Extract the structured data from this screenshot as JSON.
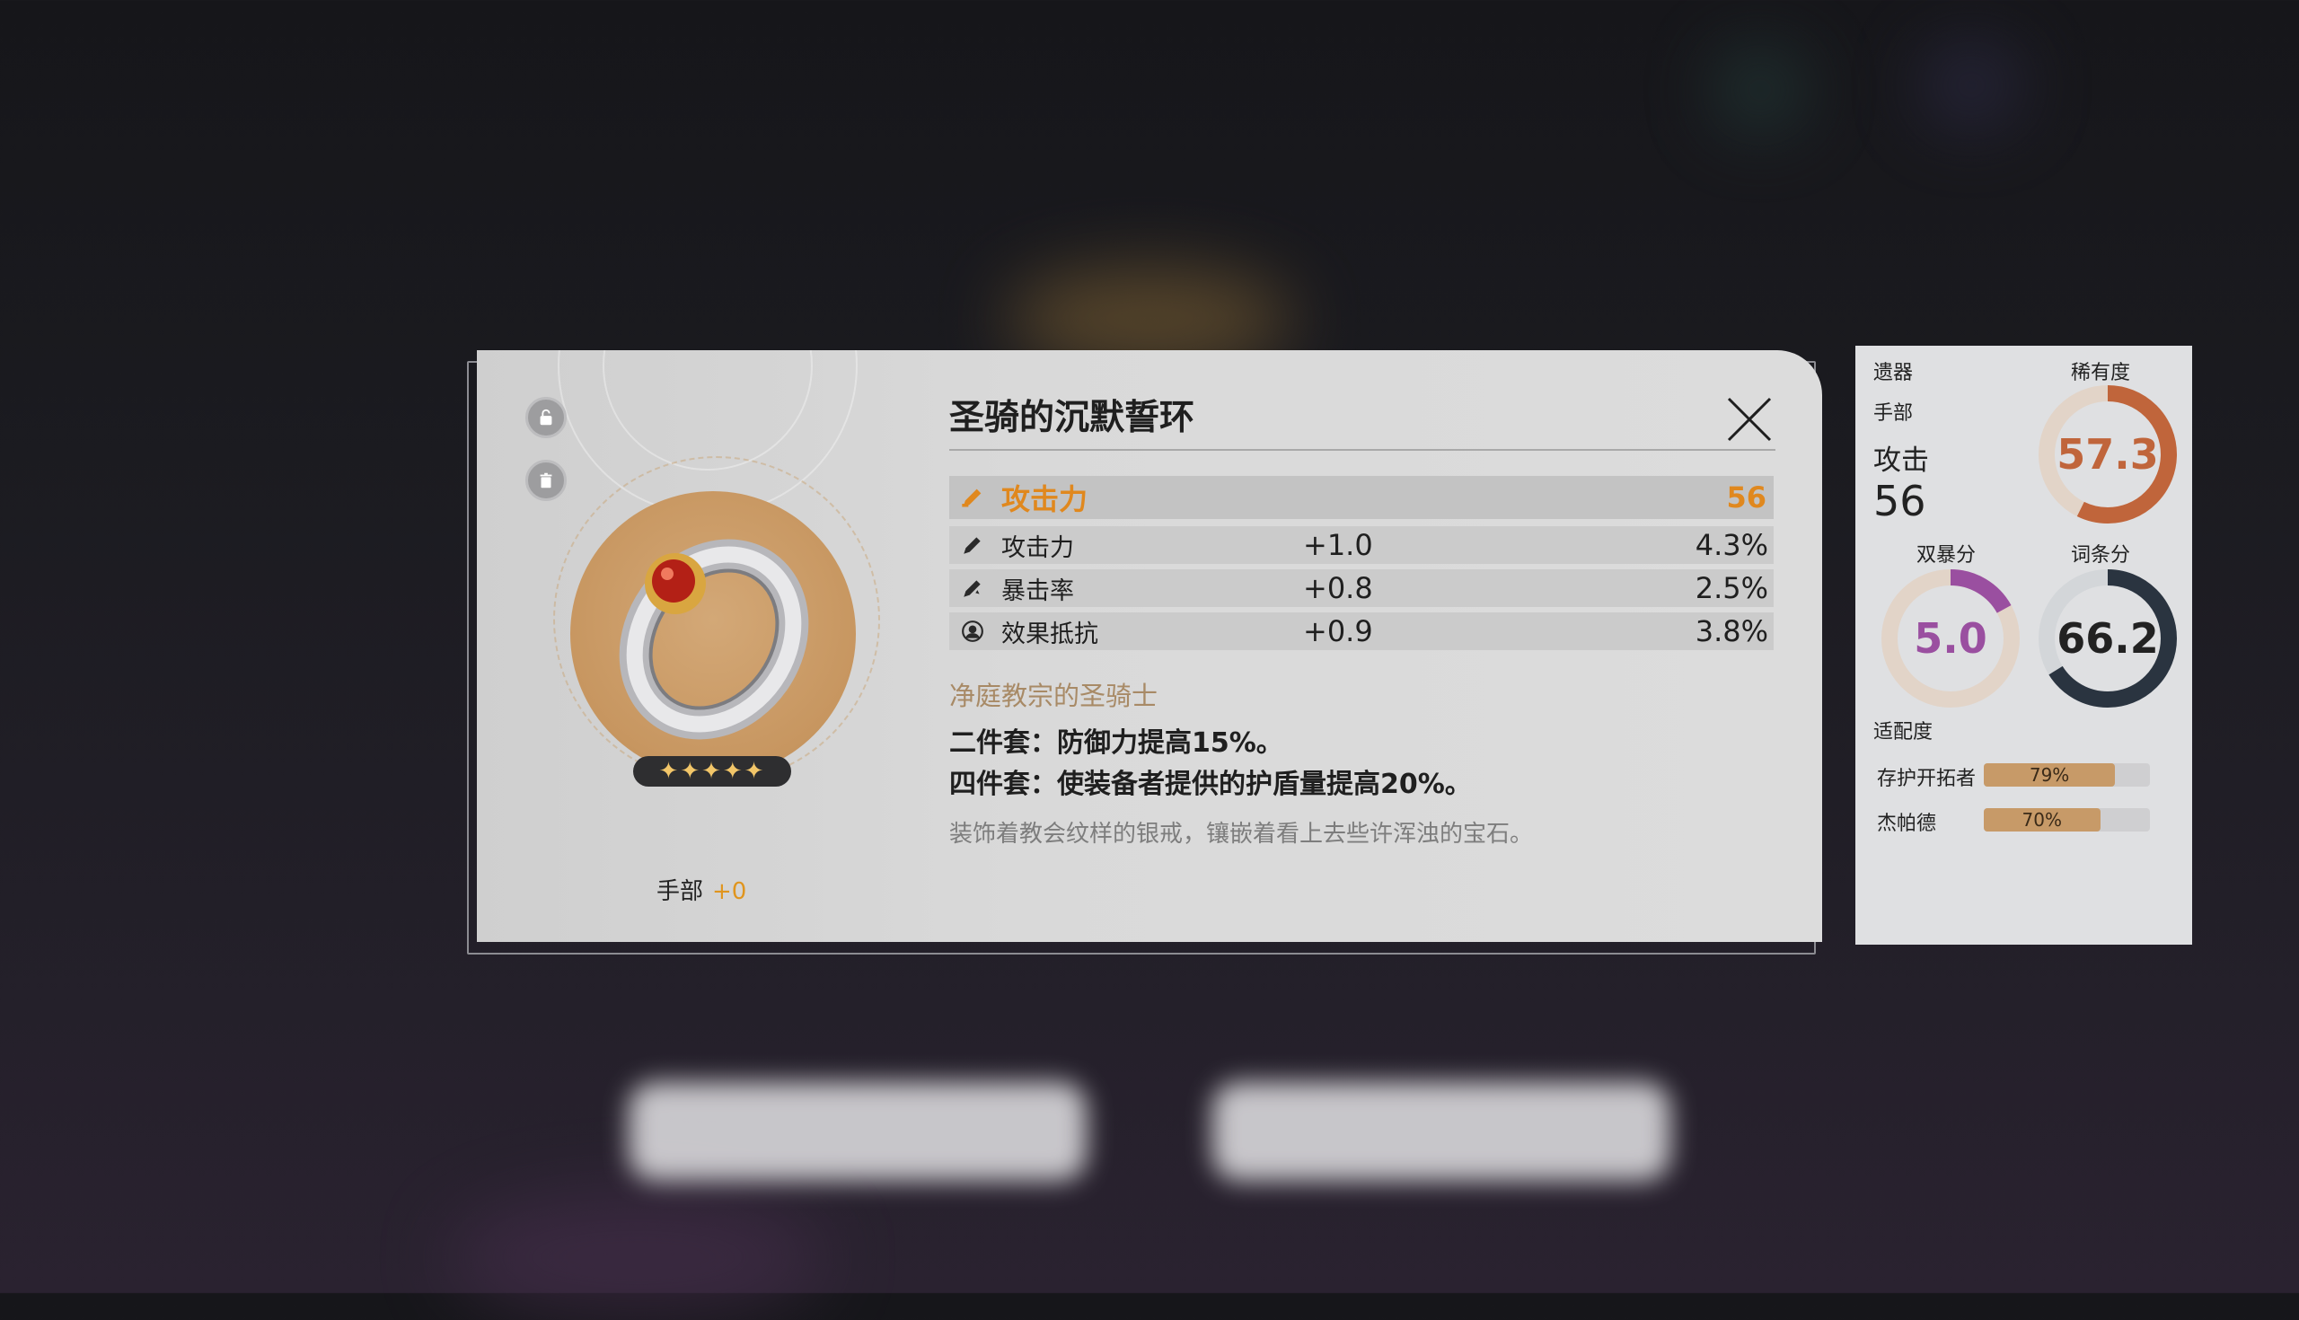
{
  "relic": {
    "name": "圣骑的沉默誓环",
    "slot_label": "手部",
    "level": "+0",
    "stars": "✦✦✦✦✦",
    "main_stat": {
      "name": "攻击力",
      "value": "56",
      "icon": "attack-sword-icon"
    },
    "sub_stats": [
      {
        "name": "攻击力",
        "add": "+1.0",
        "pct": "4.3%",
        "icon": "attack-sword-icon"
      },
      {
        "name": "暴击率",
        "add": "+0.8",
        "pct": "2.5%",
        "icon": "crit-rate-icon"
      },
      {
        "name": "效果抵抗",
        "add": "+0.9",
        "pct": "3.8%",
        "icon": "effect-res-icon"
      }
    ],
    "set_name": "净庭教宗的圣骑士",
    "set_bonus_2": "二件套：防御力提高15%。",
    "set_bonus_4": "四件套：使装备者提供的护盾量提高20%。",
    "description": "装饰着教会纹样的银戒，镶嵌着看上去些许浑浊的宝石。"
  },
  "score_panel": {
    "category": "遗器",
    "slot": "手部",
    "main_stat_name": "攻击",
    "main_stat_value": "56",
    "rarity_label": "稀有度",
    "rarity_score": "57.3",
    "rarity_fraction": 0.573,
    "rarity_color": "#c0653b",
    "crit_label": "双暴分",
    "crit_score": "5.0",
    "crit_fraction": 0.17,
    "crit_color": "#9a4fa0",
    "substat_label": "词条分",
    "substat_score": "66.2",
    "substat_fraction": 0.662,
    "substat_color": "#2a3440",
    "fit_label": "适配度",
    "fits": [
      {
        "name": "存护开拓者",
        "pct_text": "79%",
        "pct": 79
      },
      {
        "name": "杰帕德",
        "pct_text": "70%",
        "pct": 70
      }
    ]
  }
}
